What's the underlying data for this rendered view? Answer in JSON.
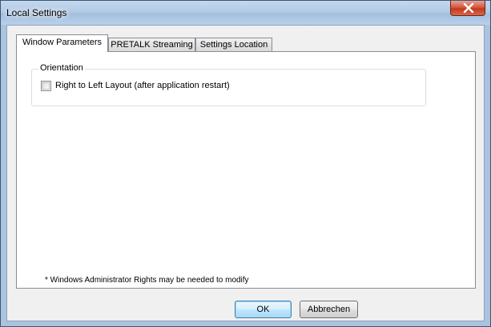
{
  "window": {
    "title": "Local Settings"
  },
  "tabs": [
    {
      "label": "Window Parameters",
      "active": true
    },
    {
      "label": "PRETALK Streaming",
      "active": false
    },
    {
      "label": "Settings Location",
      "active": false
    }
  ],
  "orientation_group": {
    "legend": "Orientation",
    "checkbox_label": "Right to Left Layout (after application restart)",
    "checkbox_checked": false
  },
  "footnote": "* Windows Administrator Rights may be needed to modify",
  "buttons": {
    "ok_label": "OK",
    "cancel_label": "Abbrechen"
  },
  "colors": {
    "titlebar": "#b3cbe6",
    "close_button": "#c23a1e",
    "client_background": "#f0f0f0",
    "default_button_border": "#3c7fb1"
  },
  "icons": {
    "close": "close-icon"
  }
}
